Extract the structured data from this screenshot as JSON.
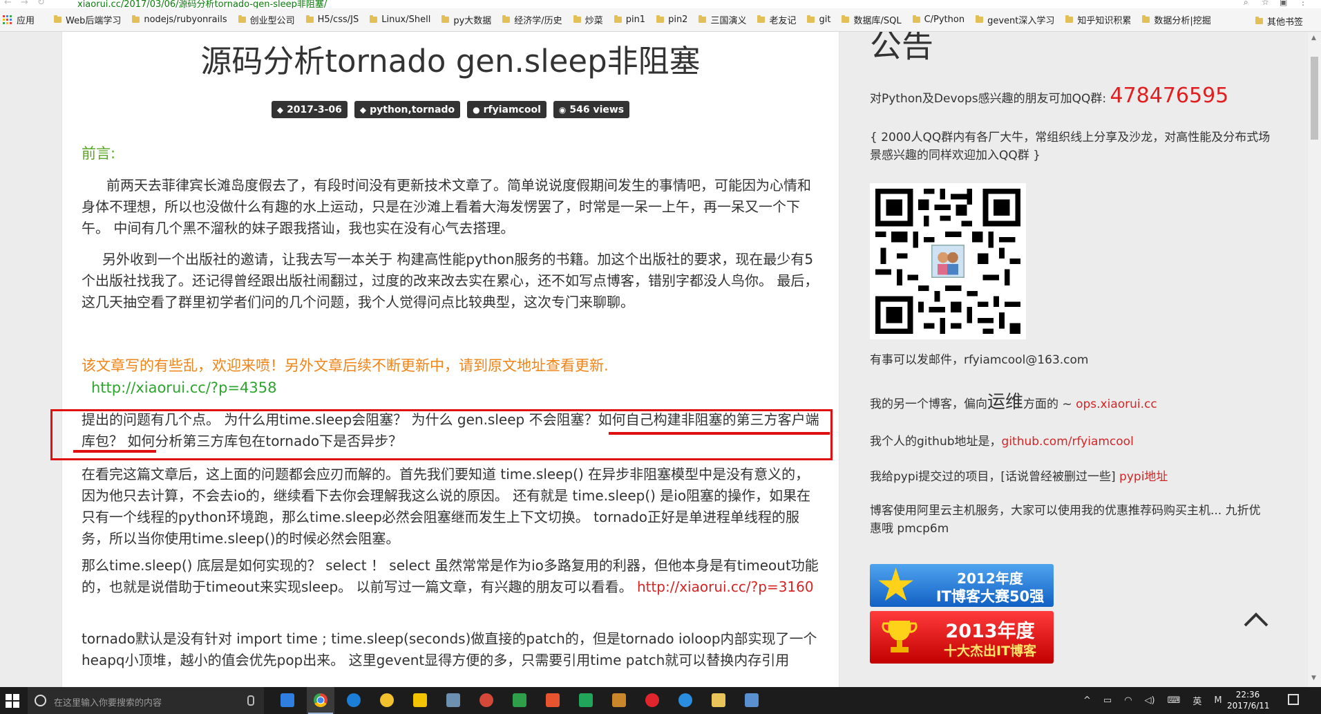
{
  "browser": {
    "url": "xiaorui.cc/2017/03/06/源码分析tornado-gen-sleep非阻塞/",
    "bookmarks_apps_label": "应用",
    "bookmarks": [
      "Web后端学习",
      "nodejs/rubyonrails",
      "创业型公司",
      "H5/css/JS",
      "Linux/Shell",
      "py大数据",
      "经济学/历史",
      "炒菜",
      "pin1",
      "pin2",
      "三国演义",
      "老友记",
      "git",
      "数据库/SQL",
      "C/Python",
      "gevent深入学习",
      "知乎知识积累",
      "数据分析|挖掘"
    ],
    "other_bookmarks": "其他书签"
  },
  "article": {
    "title": "源码分析tornado gen.sleep非阻塞",
    "meta": {
      "date": "2017-3-06",
      "tags": "python,tornado",
      "author": "rfyiamcool",
      "views": "546 views"
    },
    "preface_heading": "前言:",
    "para1": "前两天去菲律宾长滩岛度假去了，有段时间没有更新技术文章了。简单说说度假期间发生的事情吧，可能因为心情和身体不理想，所以也没做什么有趣的水上运动，只是在沙滩上看着大海发愣罢了，时常是一呆一上午，再一呆又一个下午。 中间有几个黑不溜秋的妹子跟我搭讪，我也实在没有心气去搭理。",
    "para2": "另外收到一个出版社的邀请，让我去写一本关于 构建高性能python服务的书籍。加这个出版社的要求，现在最少有5个出版社找我了。还记得曾经跟出版社闹翻过，过度的改来改去实在累心，还不如写点博客，错别字都没人鸟你。  最后，这几天抽空看了群里初学者们问的几个问题，我个人觉得问点比较典型，这次专门来聊聊。",
    "note": "该文章写的有些乱，欢迎来喷！另外文章后续不断更新中，请到原文地址查看更新.",
    "note_url": "http://xiaorui.cc/?p=4358",
    "question": "提出的问题有几个点。 为什么用time.sleep会阻塞？ 为什么 gen.sleep 不会阻塞？如何自己构建非阻塞的第三方客户端库包？ 如何分析第三方库包在tornado下是否异步？",
    "para3": "在看完这篇文章后，这上面的问题都会应刃而解的。首先我们要知道 time.sleep() 在异步非阻塞模型中是没有意义的，因为他只去计算，不会去io的，继续看下去你会理解我这么说的原因。   还有就是 time.sleep() 是io阻塞的操作，如果在只有一个线程的python环境跑，那么time.sleep必然会阻塞继而发生上下文切换。  tornado正好是单进程单线程的服务，所以当你使用time.sleep()的时候必然会阻塞。",
    "para4_text": "那么time.sleep() 底层是如何实现的？  select ！  select 虽然常常是作为io多路复用的利器，但他本身是有timeout功能的，也就是说借助于timeout来实现sleep。 以前写过一篇文章，有兴趣的朋友可以看看。 ",
    "para4_link": "http://xiaorui.cc/?p=3160",
    "para5": "tornado默认是没有针对 import time ; time.sleep(seconds)做直接的patch的，但是tornado ioloop内部实现了一个heapq小顶堆，越小的值会优先pop出来。  这里gevent显得方便的多，只需要引用time patch就可以替换内存引用"
  },
  "sidebar": {
    "announcement_heading": "公告",
    "qq_text": "对Python及Devops感兴趣的朋友可加QQ群: ",
    "qq_number": "478476595",
    "qq_intro": "{ 2000人QQ群内有各厂大牛，常组织线上分享及沙龙，对高性能及分布式场景感兴趣的同样欢迎加入QQ群 }",
    "email": "有事可以发邮件，rfyiamcool@163.com",
    "ops_prefix": "我的另一个博客，偏向",
    "ops_big": "运维",
    "ops_mid": "方面的 ~ ",
    "ops_link": "ops.xiaorui.cc",
    "github_prefix": "我个人的github地址是，",
    "github_link": "github.com/rfyiamcool",
    "pypi_prefix": "我给pypi提交过的项目，[话说曾经被删过一些]  ",
    "pypi_link": "pypi地址",
    "aliyun": "博客使用阿里云主机服务，大家可以使用我的优惠推荐码购买主机... 九折优惠哦    pmcp6m",
    "badge2012_line1": "2012年度",
    "badge2012_line2": "IT博客大赛50强",
    "badge2013_line1": "2013年度",
    "badge2013_line2": "十大杰出IT博客"
  },
  "taskbar": {
    "search_placeholder": "在这里输入你要搜索的内容",
    "ime": "英",
    "ime_mode": "M",
    "time": "22:36",
    "date": "2017/6/11"
  },
  "colors": {
    "accent_green": "#56a61e",
    "note_orange": "#f08416",
    "link_red": "#d42525",
    "highlight_red": "#e01010"
  }
}
